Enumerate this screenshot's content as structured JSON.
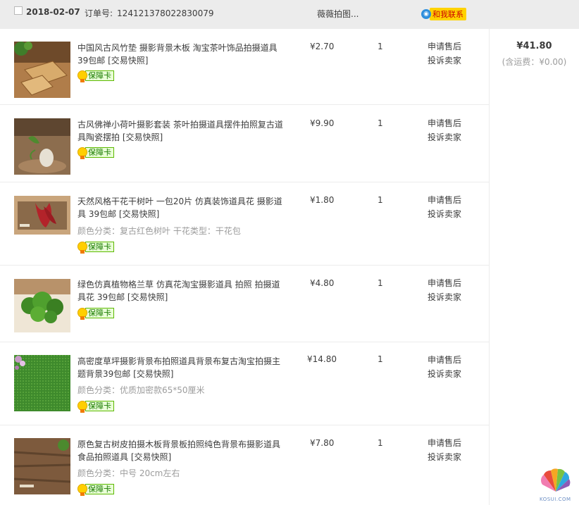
{
  "order": {
    "date": "2018-02-07",
    "order_label": "订单号:",
    "order_number": "124121378022830079",
    "shop_name": "薇薇拍图...",
    "contact_label": "和我联系"
  },
  "total": {
    "amount": "¥41.80",
    "shipping": "(含运费：¥0.00)"
  },
  "badge_label": "保障卡",
  "actions": {
    "after_sale": "申请售后",
    "complaint": "投诉卖家"
  },
  "items": [
    {
      "title": "中国风古风竹垫 摄影背景木板 淘宝茶叶饰品拍摄道具 39包邮",
      "snapshot": "[交易快照]",
      "attr": "",
      "price": "¥2.70",
      "qty": "1"
    },
    {
      "title": "古风佛禅小荷叶摄影套装 茶叶拍摄道具摆件拍照复古道具陶瓷摆拍",
      "snapshot": "[交易快照]",
      "attr": "",
      "price": "¥9.90",
      "qty": "1"
    },
    {
      "title": "天然风格干花干树叶 一包20片 仿真装饰道具花 摄影道具 39包邮",
      "snapshot": "[交易快照]",
      "attr": "颜色分类：复古红色树叶   干花类型：干花包",
      "price": "¥1.80",
      "qty": "1"
    },
    {
      "title": "绿色仿真植物格兰草 仿真花淘宝摄影道具 拍照 拍摄道具花 39包邮",
      "snapshot": "[交易快照]",
      "attr": "",
      "price": "¥4.80",
      "qty": "1"
    },
    {
      "title": "高密度草坪摄影背景布拍照道具背景布复古淘宝拍摄主题背景39包邮",
      "snapshot": "[交易快照]",
      "attr": "颜色分类：优质加密款65*50厘米",
      "price": "¥14.80",
      "qty": "1"
    },
    {
      "title": "原色复古树皮拍摄木板背景板拍照纯色背景布摄影道具食品拍照道具",
      "snapshot": "[交易快照]",
      "attr": "颜色分类：中号 20cm左右",
      "price": "¥7.80",
      "qty": "1"
    }
  ],
  "watermark_text": "KOSUI.COM",
  "colors": {
    "header_bg": "#ececec",
    "badge_green": "#5cb800",
    "contact_yellow": "#ffd200",
    "contact_red": "#cc0000",
    "muted_text": "#9c9c9c"
  },
  "icons": [
    "checkbox-icon",
    "wangwang-chat-icon",
    "guarantee-medal-icon",
    "watermark-logo-icon"
  ]
}
